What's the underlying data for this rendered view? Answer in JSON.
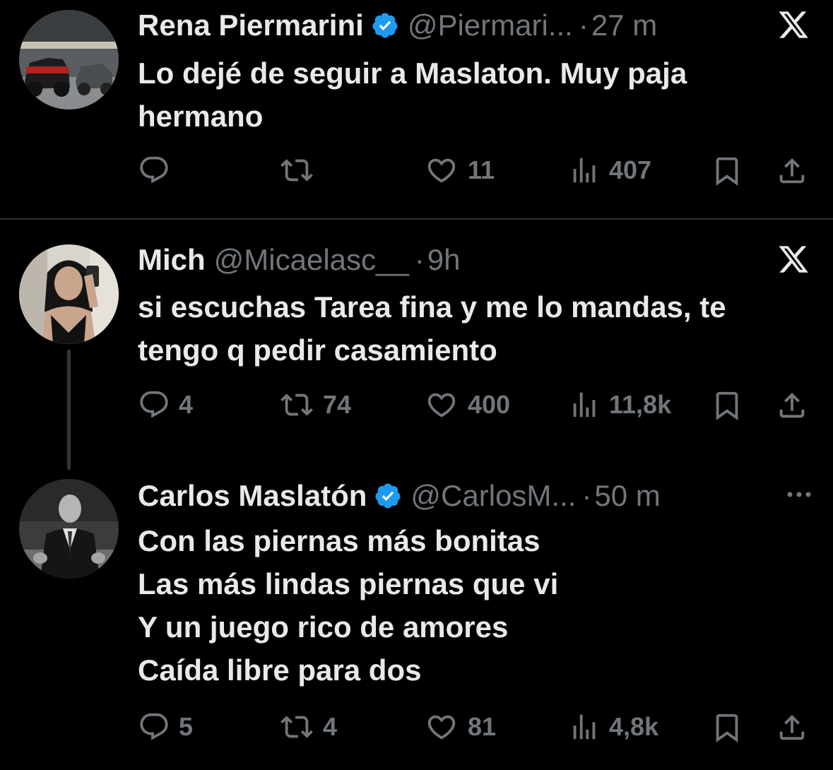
{
  "tweets": [
    {
      "name": "Rena Piermarini",
      "verified": true,
      "handle": "@Piermari...",
      "dot": "·",
      "time": "27 m",
      "text": "Lo dejé de seguir a Maslaton. Muy paja\nhermano",
      "corner_icon": "x-logo-icon",
      "reply_count": "",
      "retweet_count": "",
      "like_count": "11",
      "view_count": "407"
    },
    {
      "name": "Mich",
      "verified": false,
      "handle": "@Micaelasc__",
      "dot": "·",
      "time": "9h",
      "text": "si escuchas Tarea fina y me lo mandas, te\ntengo q pedir casamiento",
      "corner_icon": "x-logo-icon",
      "reply_count": "4",
      "retweet_count": "74",
      "like_count": "400",
      "view_count": "11,8k"
    },
    {
      "name": "Carlos Maslatón",
      "verified": true,
      "handle": "@CarlosM...",
      "dot": "·",
      "time": "50 m",
      "text": "Con las piernas más bonitas\nLas más lindas piernas que vi\nY un juego rico de amores\nCaída libre para dos",
      "corner_icon": "more-dots-icon",
      "reply_count": "5",
      "retweet_count": "4",
      "like_count": "81",
      "view_count": "4,8k"
    }
  ],
  "colors": {
    "background": "#000000",
    "text": "#e7e9ea",
    "secondary": "#71767b",
    "verified": "#1d9bf0",
    "divider": "#2f3336"
  }
}
